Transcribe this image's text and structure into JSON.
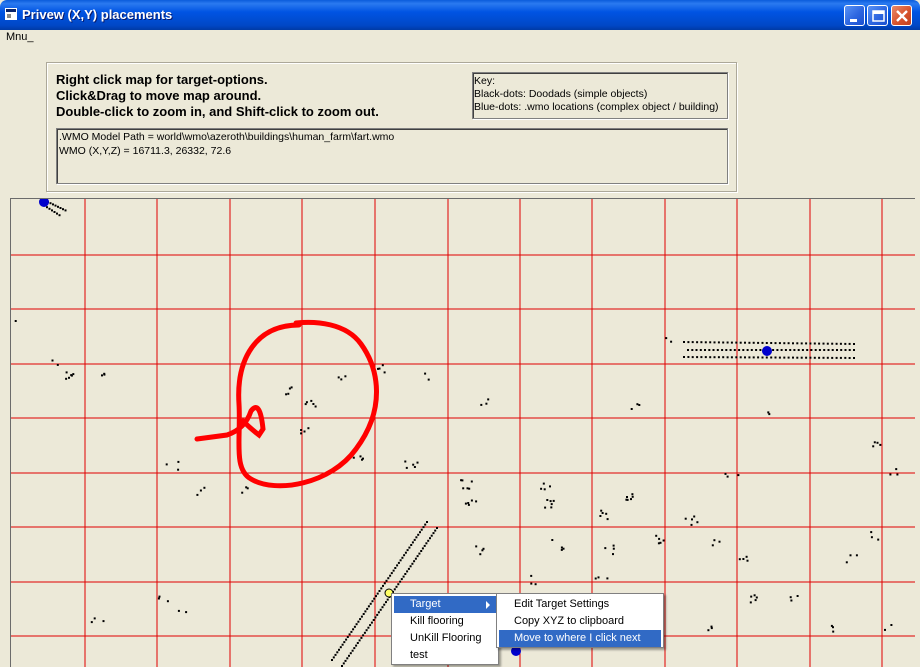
{
  "window": {
    "title": "Privew (X,Y) placements"
  },
  "menu": {
    "items": [
      {
        "label": "Mnu_"
      }
    ]
  },
  "instructions": [
    "Right click map for target-options.",
    "Click&Drag to move map around.",
    "Double-click to zoom in, and Shift-click to zoom out."
  ],
  "key": {
    "title": "Key:",
    "lines": [
      "Black-dots: Doodads (simple objects)",
      "Blue-dots: .wmo locations (complex object / building)"
    ]
  },
  "info": {
    "model_path": ".WMO Model Path = world\\wmo\\azeroth\\buildings\\human_farm\\fart.wmo",
    "coords": "WMO (X,Y,Z) = 16711.3, 26332, 72.6"
  },
  "map": {
    "grid_color": "#e00000",
    "dot_color": "#000000",
    "wmo_color": "#0000cc",
    "highlight_color": "#ffff66"
  },
  "context_menu": {
    "items": [
      {
        "label": "Target",
        "has_submenu": true,
        "selected": true
      },
      {
        "label": "Kill flooring"
      },
      {
        "label": "UnKill Flooring"
      },
      {
        "label": "test"
      }
    ]
  },
  "submenu": {
    "items": [
      {
        "label": "Edit Target Settings"
      },
      {
        "label": "Copy XYZ to clipboard"
      },
      {
        "label": "Move to where I click next",
        "selected": true
      }
    ]
  },
  "colors": {
    "titlebar": "#0054e3",
    "selection": "#316ac5",
    "annotation": "#ff0000"
  }
}
